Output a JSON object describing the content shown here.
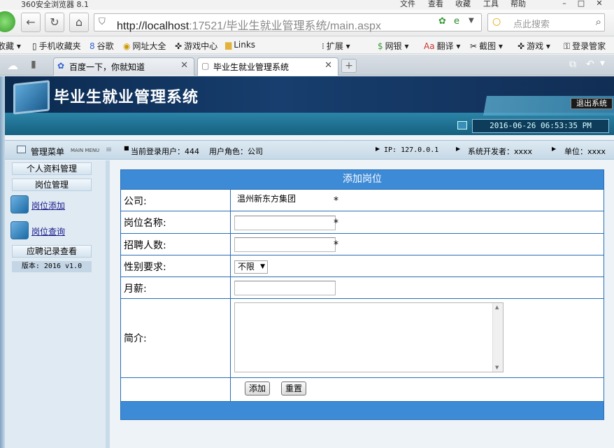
{
  "browser": {
    "title": "360安全浏览器 8.1",
    "menus": [
      "文件",
      "查看",
      "收藏",
      "工具",
      "帮助"
    ],
    "url_host": "http://localhost",
    "url_rest": ":17521/毕业生就业管理系统/main.aspx",
    "search_placeholder": "点此搜索",
    "bookmarks": [
      "收藏",
      "手机收藏夹",
      "谷歌",
      "网址大全",
      "游戏中心",
      "Links",
      "扩展",
      "网银",
      "翻译",
      "截图",
      "游戏",
      "登录管家"
    ],
    "tabs": [
      {
        "label": "百度一下，你就知道",
        "active": false
      },
      {
        "label": "毕业生就业管理系统",
        "active": true
      }
    ]
  },
  "app": {
    "title": "毕业生就业管理系统",
    "logout_label": "退出系统",
    "datetime": "2016-06-26 06:53:35 PM"
  },
  "infobar": {
    "menu_label": "管理菜单",
    "menu_sub": "MAIN MENU",
    "current_user": "当前登录用户：444",
    "user_role": "用户角色：公司",
    "ip": "IP: 127.0.0.1",
    "developer": "系统开发者：xxxx",
    "unit": "单位：xxxx"
  },
  "sidebar": {
    "groups": [
      "个人资料管理",
      "岗位管理",
      "应聘记录查看"
    ],
    "links": [
      "岗位添加",
      "岗位查询"
    ],
    "version": "版本: 2016 v1.0"
  },
  "form": {
    "title": "添加岗位",
    "company_label": "公司:",
    "company_value": "温州新东方集团",
    "job_name_label": "岗位名称:",
    "job_name_value": "",
    "headcount_label": "招聘人数:",
    "headcount_value": "",
    "gender_label": "性别要求:",
    "gender_value": "不限",
    "salary_label": "月薪:",
    "salary_value": "",
    "intro_label": "简介:",
    "required_mark": "*",
    "add_button": "添加",
    "reset_button": "重置"
  }
}
